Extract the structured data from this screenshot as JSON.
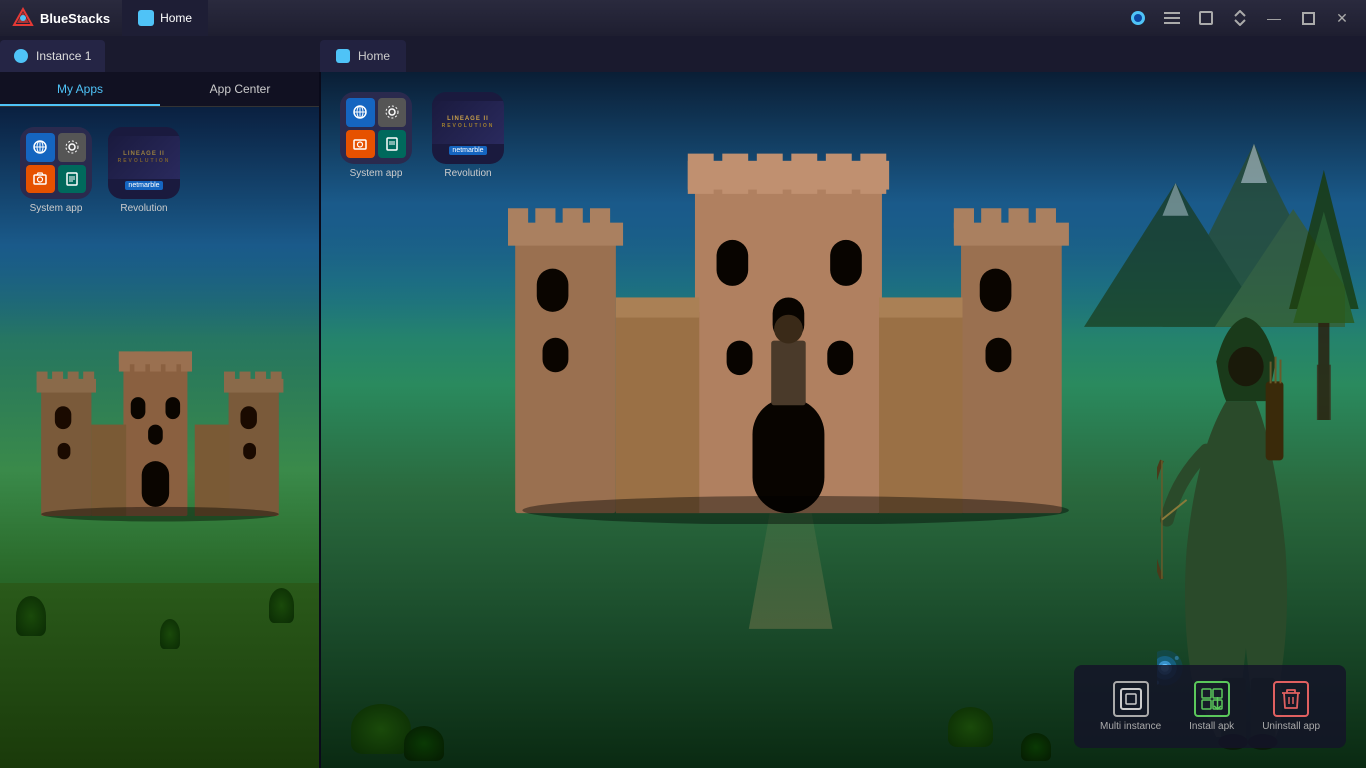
{
  "app": {
    "brand": "BlueStacks",
    "title_bar_tab_label": "Home"
  },
  "title_bar": {
    "controls": {
      "minimize": "—",
      "maximize": "⧠",
      "close": "✕",
      "settings": "☰",
      "profile_icon": "●"
    }
  },
  "left_panel": {
    "instance_tab": "Instance 1",
    "home_tab": "Home",
    "nav_tabs": [
      {
        "id": "my-apps",
        "label": "My Apps",
        "active": true
      },
      {
        "id": "app-center",
        "label": "App Center",
        "active": false
      }
    ],
    "apps": [
      {
        "id": "system-app",
        "label": "System app",
        "type": "grid"
      },
      {
        "id": "revolution",
        "label": "Revolution",
        "type": "single"
      }
    ]
  },
  "second_window": {
    "home_tab": "Home",
    "apps": [
      {
        "id": "system-app-main",
        "label": "System app",
        "type": "grid"
      },
      {
        "id": "revolution-main",
        "label": "Revolution",
        "type": "single"
      }
    ]
  },
  "bottom_toolbar": {
    "buttons": [
      {
        "id": "multi-instance",
        "label": "Multi instance",
        "icon": "⬜"
      },
      {
        "id": "install-apk",
        "label": "Install apk",
        "icon": "⊞"
      },
      {
        "id": "uninstall-app",
        "label": "Uninstall app",
        "icon": "🗑"
      }
    ]
  }
}
